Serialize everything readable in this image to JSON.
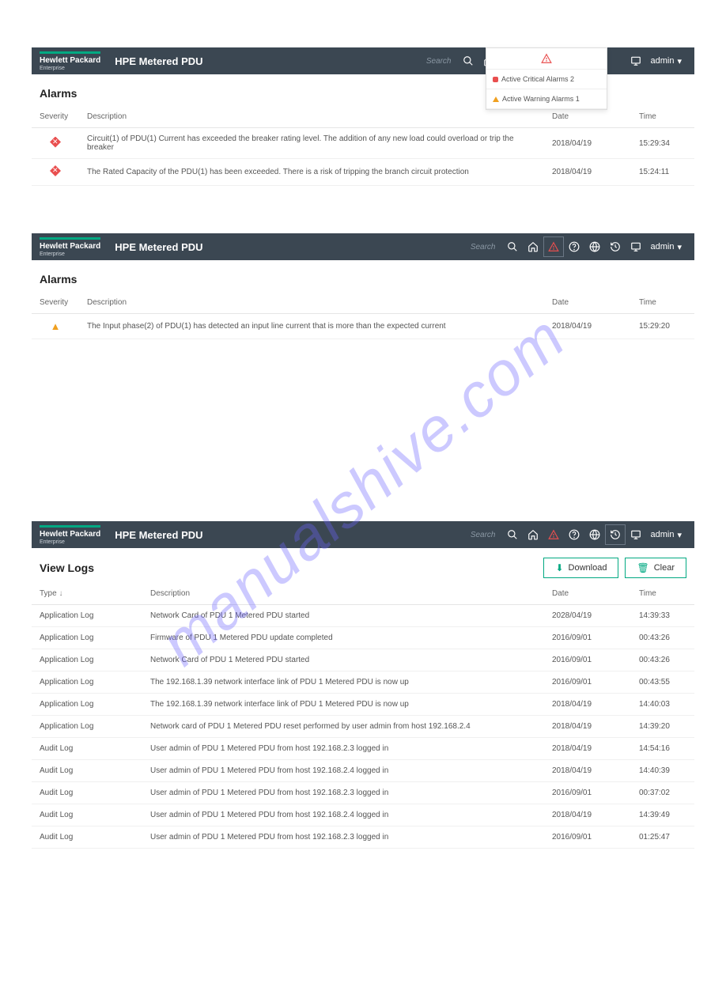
{
  "brand": {
    "line1": "Hewlett Packard",
    "line2": "Enterprise"
  },
  "product_title": "HPE Metered PDU",
  "search_placeholder": "Search",
  "user_label": "admin",
  "watermark": "manualshive.com",
  "popup": {
    "critical": "Active Critical Alarms 2",
    "warning": "Active Warning Alarms 1"
  },
  "panel1": {
    "title": "Alarms",
    "headers": {
      "sev": "Severity",
      "desc": "Description",
      "date": "Date",
      "time": "Time"
    },
    "rows": [
      {
        "sev": "critical",
        "desc": "Circuit(1) of PDU(1) Current has exceeded the breaker rating level. The addition of any new load could overload or trip the breaker",
        "date": "2018/04/19",
        "time": "15:29:34"
      },
      {
        "sev": "critical",
        "desc": "The Rated Capacity of the PDU(1) has been exceeded. There is a risk of tripping the branch circuit protection",
        "date": "2018/04/19",
        "time": "15:24:11"
      }
    ]
  },
  "panel2": {
    "title": "Alarms",
    "headers": {
      "sev": "Severity",
      "desc": "Description",
      "date": "Date",
      "time": "Time"
    },
    "rows": [
      {
        "sev": "warning",
        "desc": "The Input phase(2) of PDU(1) has detected an input line current that is more than the expected current",
        "date": "2018/04/19",
        "time": "15:29:20"
      }
    ]
  },
  "panel3": {
    "title": "View Logs",
    "download_label": "Download",
    "clear_label": "Clear",
    "headers": {
      "type": "Type",
      "desc": "Description",
      "date": "Date",
      "time": "Time"
    },
    "rows": [
      {
        "type": "Application Log",
        "desc": "Network Card of PDU 1 Metered PDU started",
        "date": "2028/04/19",
        "time": "14:39:33"
      },
      {
        "type": "Application Log",
        "desc": "Firmware of PDU 1 Metered PDU update completed",
        "date": "2016/09/01",
        "time": "00:43:26"
      },
      {
        "type": "Application Log",
        "desc": "Network Card of PDU 1 Metered PDU started",
        "date": "2016/09/01",
        "time": "00:43:26"
      },
      {
        "type": "Application Log",
        "desc": "The 192.168.1.39 network interface link of PDU 1 Metered PDU is now up",
        "date": "2016/09/01",
        "time": "00:43:55"
      },
      {
        "type": "Application Log",
        "desc": "The 192.168.1.39 network interface link of PDU 1 Metered PDU is now up",
        "date": "2018/04/19",
        "time": "14:40:03"
      },
      {
        "type": "Application Log",
        "desc": "Network card of PDU 1 Metered PDU reset performed by user admin from host 192.168.2.4",
        "date": "2018/04/19",
        "time": "14:39:20"
      },
      {
        "type": "Audit Log",
        "desc": "User admin of PDU 1 Metered PDU from host 192.168.2.3 logged in",
        "date": "2018/04/19",
        "time": "14:54:16"
      },
      {
        "type": "Audit Log",
        "desc": "User admin of PDU 1 Metered PDU from host 192.168.2.4 logged in",
        "date": "2018/04/19",
        "time": "14:40:39"
      },
      {
        "type": "Audit Log",
        "desc": "User admin of PDU 1 Metered PDU from host 192.168.2.3 logged in",
        "date": "2016/09/01",
        "time": "00:37:02"
      },
      {
        "type": "Audit Log",
        "desc": "User admin of PDU 1 Metered PDU from host 192.168.2.4 logged in",
        "date": "2018/04/19",
        "time": "14:39:49"
      },
      {
        "type": "Audit Log",
        "desc": "User admin of PDU 1 Metered PDU from host 192.168.2.3 logged in",
        "date": "2016/09/01",
        "time": "01:25:47"
      }
    ]
  }
}
